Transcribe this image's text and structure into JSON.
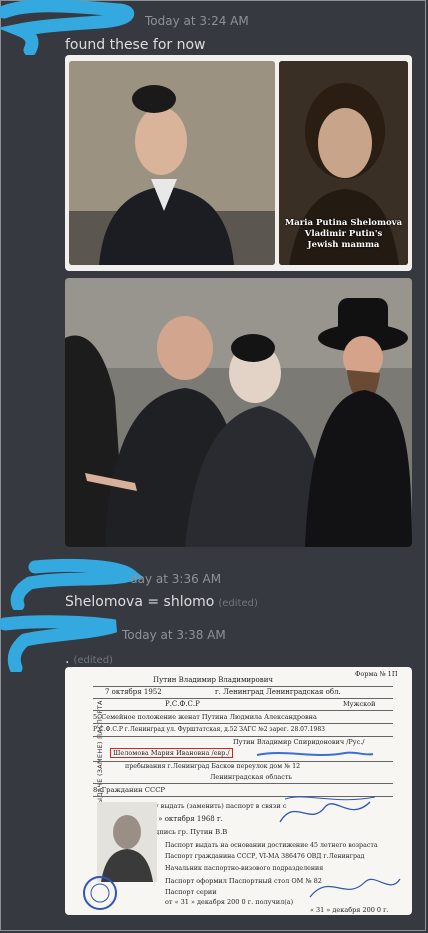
{
  "messages": [
    {
      "timestamp": "Today at 3:24 AM",
      "text": "found these for now",
      "attachments": [
        {
          "caption": [
            "Maria Putina Shelomova",
            "Vladimir Putin's",
            "Jewish mamma"
          ]
        },
        {}
      ]
    },
    {
      "timestamp": "day at 3:36 AM",
      "text": "Shelomova = shlomo",
      "edited": "(edited)"
    },
    {
      "timestamp": "Today at 3:38 AM",
      "text": ".",
      "edited": "(edited)",
      "document": {
        "form_no": "Форма № 1П",
        "name": "Путин Владимир Владимирович",
        "birth_date": "7 октября 1952",
        "birth_place": "г. Ленинград Ленинградская обл.",
        "republic": "Р.С.Ф.С.Р",
        "sex": "Мужской",
        "family": "5. Семейное положение   женат  Путина Людмила Александровна",
        "zags": "Р.С.Ф.С.Р г.Ленинград ул. Фурштатская, д.52 ЗАГС №2 зарег. 28.07.1983",
        "father": "Путин Владимир Спиридонович /Рус./",
        "mother": "Шеломова Мария Ивановна /евр./",
        "residence": "пребывания  г.Ленинград Басков переулок дом № 12",
        "region": "Ленинградская область",
        "citizenship": "8.  Гражданин СССР",
        "request": "Прошу выдать (заменить) паспорт в связи с",
        "date_line": "« 7 »  октября  1968 г.",
        "signature": "Подпись гр.  Путин В.В",
        "basis": "Паспорт выдать на основании достижение 45 летнего возраста",
        "passport": "Паспорт гражданина СССР, VI-МА 386476 ОВД г.Ленинград",
        "chief": "Начальник паспортно-визового подразделения",
        "office": "Паспорт оформил Паспортный стол ОМ № 82",
        "series": "Паспорт серии",
        "date2": "от « 31 » декабря 200 0 г. получил(а)",
        "date3": "« 31 » декабря  200 0 г.",
        "side_label": "ЗАЯВЛЕНИЕ О ВЫДАЧЕ (ЗАМЕНЕ) ПАСПОРТА"
      }
    }
  ]
}
